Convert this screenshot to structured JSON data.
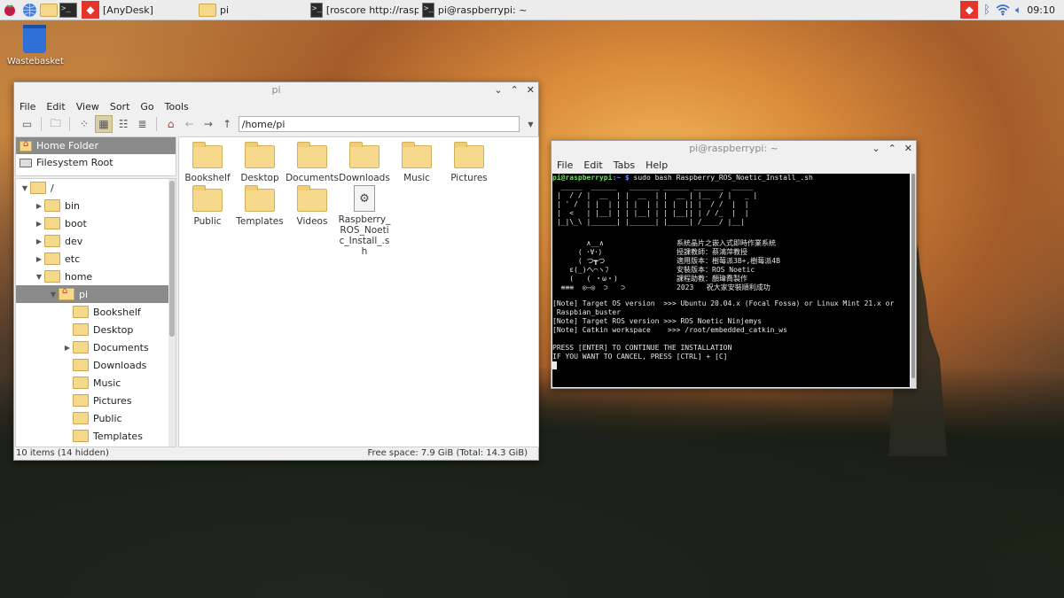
{
  "taskbar": {
    "tasks": [
      {
        "label": "[AnyDesk]"
      },
      {
        "label": "pi"
      },
      {
        "label": "[roscore http://raspbe..."
      },
      {
        "label": "pi@raspberrypi: ~"
      }
    ],
    "clock": "09:10"
  },
  "desktop": {
    "wastebasket_label": "Wastebasket"
  },
  "file_manager": {
    "title": "pi",
    "menu": [
      "File",
      "Edit",
      "View",
      "Sort",
      "Go",
      "Tools"
    ],
    "address": "/home/pi",
    "places": [
      "Home Folder",
      "Filesystem Root"
    ],
    "tree": [
      {
        "label": "/",
        "depth": 0,
        "expanded": true
      },
      {
        "label": "bin",
        "depth": 1
      },
      {
        "label": "boot",
        "depth": 1
      },
      {
        "label": "dev",
        "depth": 1
      },
      {
        "label": "etc",
        "depth": 1
      },
      {
        "label": "home",
        "depth": 1,
        "expanded": true
      },
      {
        "label": "pi",
        "depth": 2,
        "expanded": true,
        "selected": true
      },
      {
        "label": "Bookshelf",
        "depth": 3
      },
      {
        "label": "Desktop",
        "depth": 3
      },
      {
        "label": "Documents",
        "depth": 3,
        "collapsed": true
      },
      {
        "label": "Downloads",
        "depth": 3
      },
      {
        "label": "Music",
        "depth": 3
      },
      {
        "label": "Pictures",
        "depth": 3
      },
      {
        "label": "Public",
        "depth": 3
      },
      {
        "label": "Templates",
        "depth": 3
      }
    ],
    "files": [
      "Bookshelf",
      "Desktop",
      "Documents",
      "Downloads",
      "Music",
      "Pictures",
      "Public",
      "Templates",
      "Videos",
      "Raspberry_ROS_Noetic_Install_.sh"
    ],
    "status_left": "10 items (14 hidden)",
    "status_right": "Free space: 7.9 GiB (Total: 14.3 GiB)"
  },
  "terminal": {
    "title": "pi@raspberrypi: ~",
    "menu": [
      "File",
      "Edit",
      "Tabs",
      "Help"
    ],
    "prompt_user": "pi@raspberrypi",
    "prompt_path": ":~ $",
    "command": " sudo bash Raspberry_ROS_Noetic_Install_.sh",
    "ascii_art": [
      "  _____  ______   _______ ______ _______  _____ ",
      " |  / / |  __  | |  __  | |  __ | |__  / |   _ |",
      " | ' /  | |  | | | |  | | | |  || |  / /  |  |  ",
      " |  <   | |__| | | |__| | | |__|| | / /_  |  |  ",
      " |_|\\_\\ |______| |______| |_____| /____/ |__|  "
    ],
    "banner_left": [
      "        ∧__∧",
      "      ( ･∀･)",
      "      ( つ┳つ",
      "    ε(_)へ⌒ヽﾌ",
      "    (   ( ・ω・)",
      "  ≡≡≡  ◎―◎  ⊃   ⊃"
    ],
    "banner_right": [
      "系統晶片之嵌入式即時作業系統",
      "授課教師：蔡鴻萍教授",
      "適用版本：樹莓派3B+,樹莓派4B",
      "安裝版本：ROS Noetic",
      "課程助教：顏瑋喬製作",
      "2023   祝大家安裝順利成功"
    ],
    "notes": [
      "[Note] Target OS version  >>> Ubuntu 20.04.x (Focal Fossa) or Linux Mint 21.x or",
      " Raspbian_buster",
      "[Note] Target ROS version >>> ROS Noetic Ninjemys",
      "[Note] Catkin workspace    >>> /root/embedded_catkin_ws"
    ],
    "press_lines": [
      "PRESS [ENTER] TO CONTINUE THE INSTALLATION",
      "IF YOU WANT TO CANCEL, PRESS [CTRL] + [C]"
    ]
  }
}
